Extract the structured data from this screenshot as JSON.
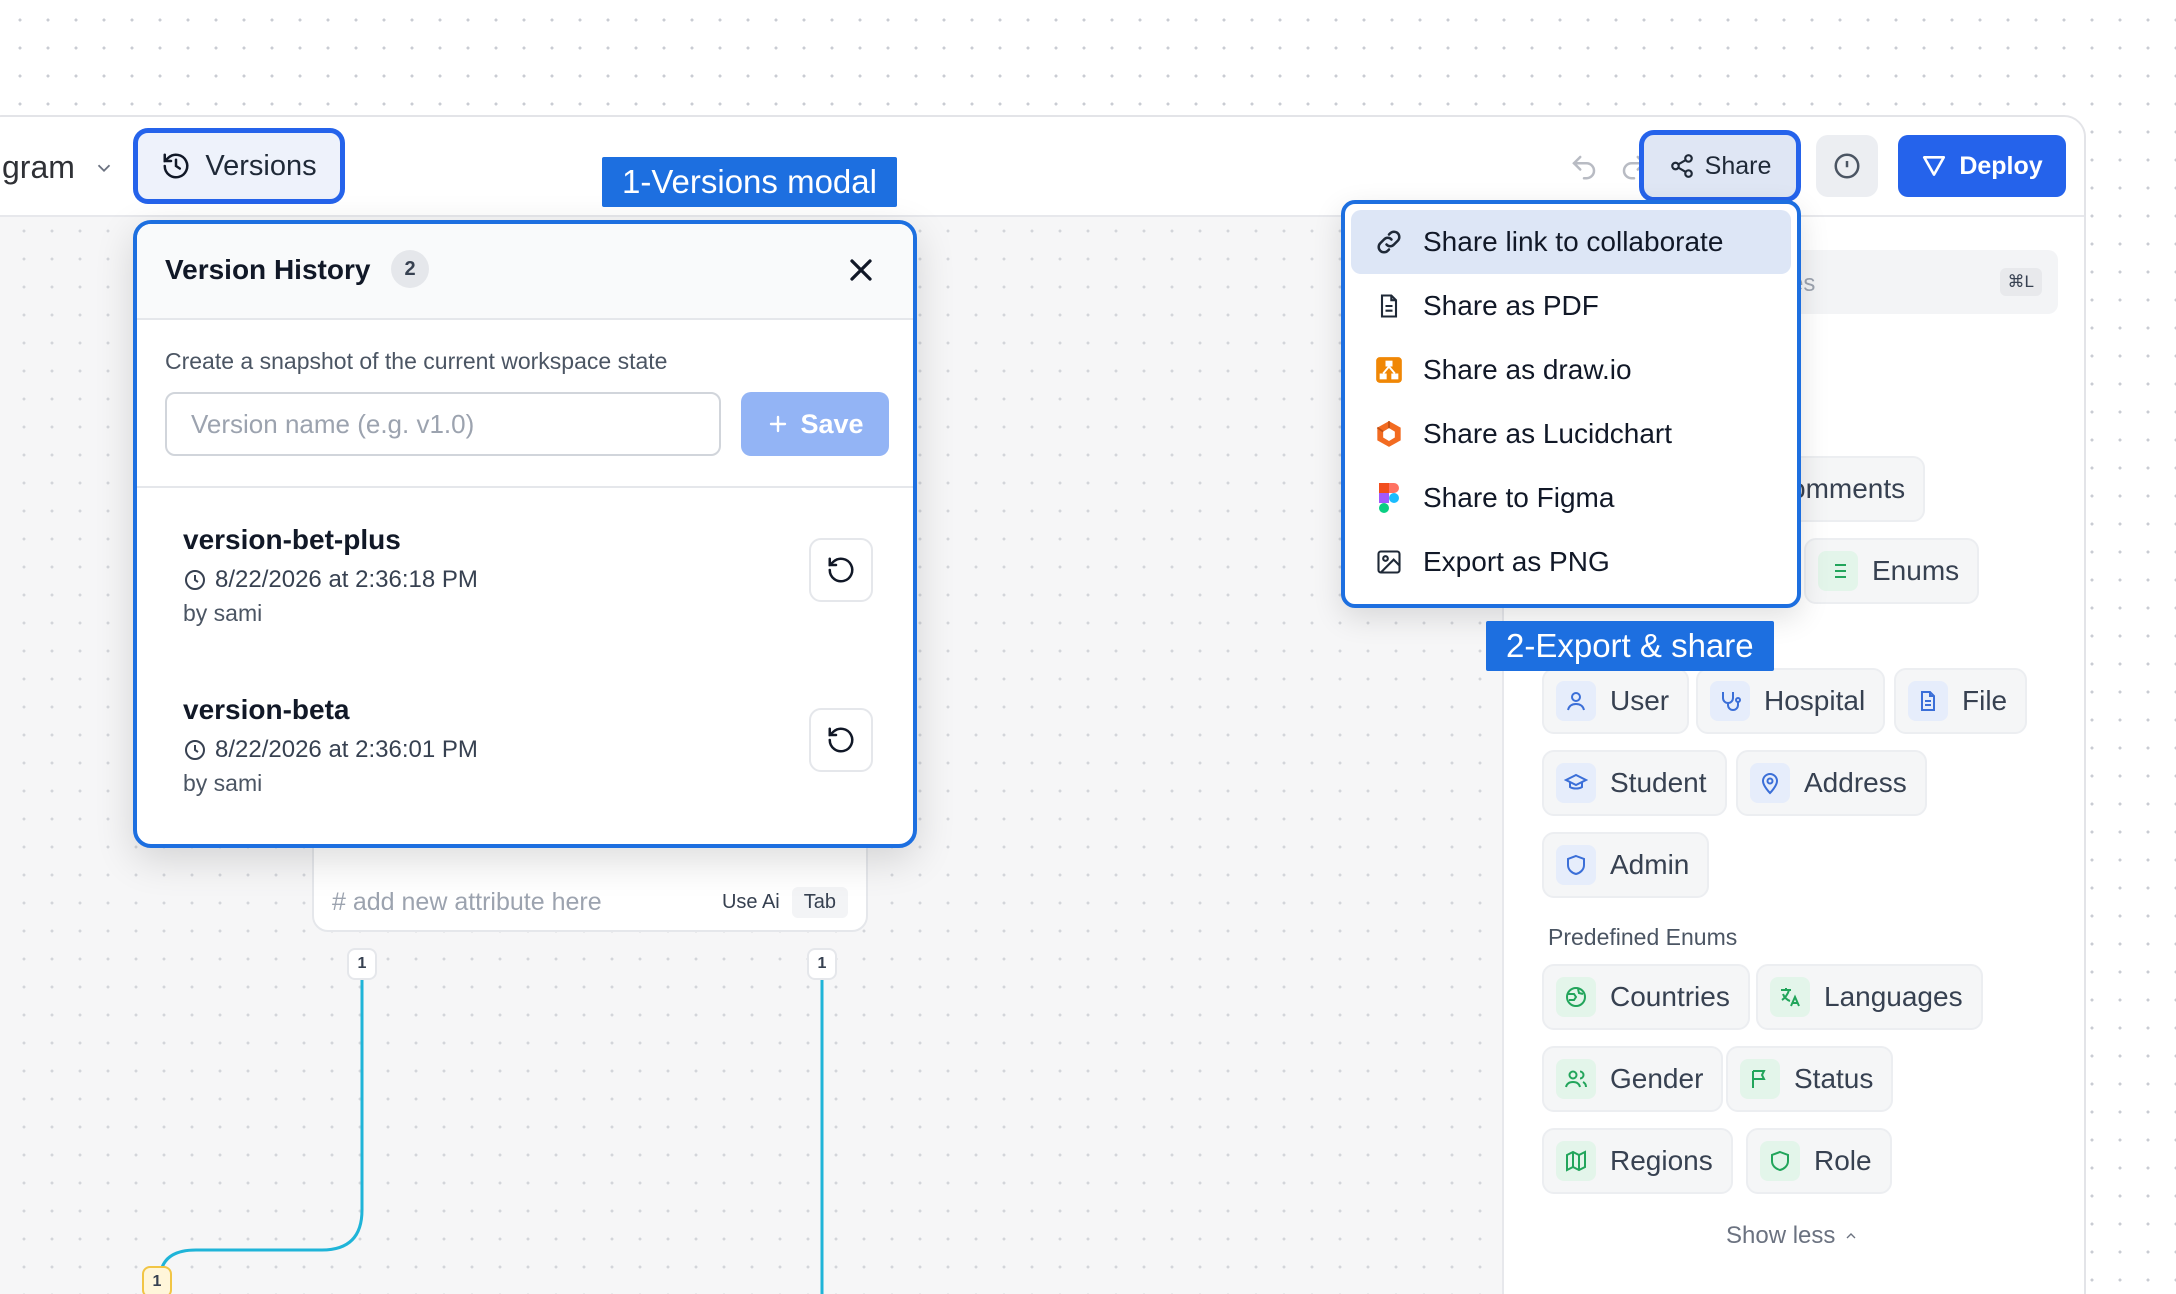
{
  "topbar": {
    "diagram_label": "gram",
    "versions_label": "Versions",
    "share_label": "Share",
    "deploy_label": "Deploy"
  },
  "annotations": {
    "versions": "1-Versions modal",
    "share": "2-Export & share"
  },
  "version_modal": {
    "title": "Version History",
    "count": "2",
    "hint": "Create a snapshot of the current workspace state",
    "input_placeholder": "Version name (e.g. v1.0)",
    "save_label": "Save",
    "versions": [
      {
        "name": "version-bet-plus",
        "date": "8/22/2026 at 2:36:18 PM",
        "by": "by sami"
      },
      {
        "name": "version-beta",
        "date": "8/22/2026 at 2:36:01 PM",
        "by": "by sami"
      }
    ]
  },
  "share_menu": {
    "items": [
      {
        "label": "Share link to collaborate",
        "icon": "link-icon"
      },
      {
        "label": "Share as PDF",
        "icon": "pdf-icon"
      },
      {
        "label": "Share as draw.io",
        "icon": "drawio-icon"
      },
      {
        "label": "Share as Lucidchart",
        "icon": "lucidchart-icon"
      },
      {
        "label": "Share to Figma",
        "icon": "figma-icon"
      },
      {
        "label": "Export as PNG",
        "icon": "image-icon"
      }
    ]
  },
  "canvas": {
    "attr_placeholder": "# add new attribute here",
    "use_ai": "Use Ai",
    "tab_key": "Tab",
    "port_label": "1"
  },
  "panel": {
    "search_placeholder": "es",
    "search_shortcut": "⌘L",
    "chips_top": [
      "omments",
      "Enums"
    ],
    "entities": [
      "User",
      "Hospital",
      "File",
      "Student",
      "Address",
      "Admin"
    ],
    "predefined_enums_label": "Predefined Enums",
    "enums": [
      "Countries",
      "Languages",
      "Gender",
      "Status",
      "Regions",
      "Role"
    ],
    "show_less": "Show less"
  },
  "colors": {
    "accent": "#2563eb",
    "annotation": "#1d6fe0",
    "connector": "#1fb4d8"
  }
}
